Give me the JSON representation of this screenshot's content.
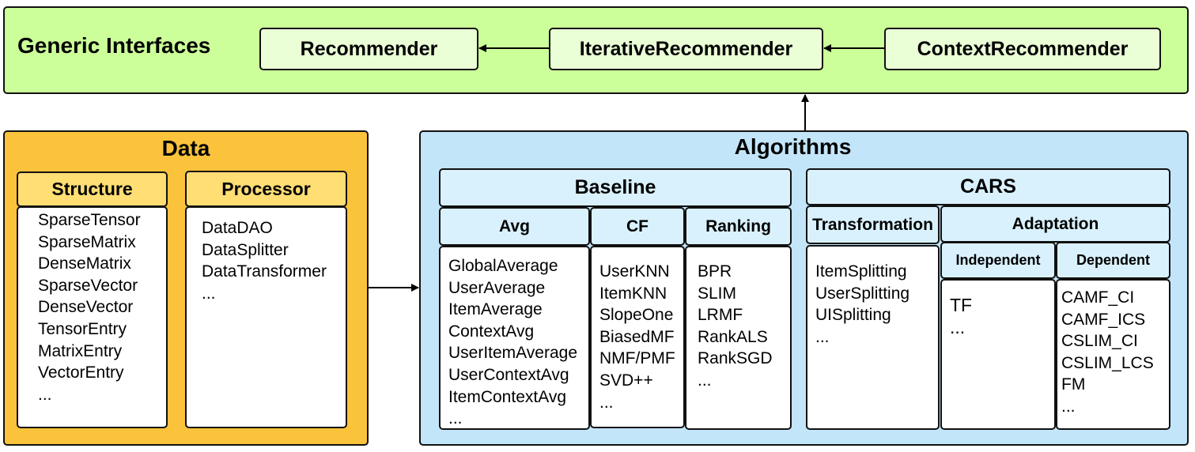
{
  "generic": {
    "title": "Generic Interfaces",
    "recommender": "Recommender",
    "iterative": "IterativeRecommender",
    "context": "ContextRecommender"
  },
  "data": {
    "title": "Data",
    "structure": {
      "label": "Structure",
      "items": [
        "SparseTensor",
        "SparseMatrix",
        "DenseMatrix",
        "SparseVector",
        "DenseVector",
        "TensorEntry",
        "MatrixEntry",
        "VectorEntry",
        "..."
      ]
    },
    "processor": {
      "label": "Processor",
      "items": [
        "DataDAO",
        "DataSplitter",
        "DataTransformer",
        "..."
      ]
    }
  },
  "algorithms": {
    "title": "Algorithms",
    "baseline": {
      "label": "Baseline",
      "avg": {
        "label": "Avg",
        "items": [
          "GlobalAverage",
          "UserAverage",
          "ItemAverage",
          "ContextAvg",
          "UserItemAverage",
          "UserContextAvg",
          "ItemContextAvg",
          "..."
        ]
      },
      "cf": {
        "label": "CF",
        "items": [
          "UserKNN",
          "ItemKNN",
          "SlopeOne",
          "BiasedMF",
          "NMF/PMF",
          "SVD++",
          "..."
        ]
      },
      "ranking": {
        "label": "Ranking",
        "items": [
          "BPR",
          "SLIM",
          "LRMF",
          "RankALS",
          "RankSGD",
          "..."
        ]
      }
    },
    "cars": {
      "label": "CARS",
      "transformation": {
        "label": "Transformation",
        "items": [
          "ItemSplitting",
          "UserSplitting",
          "UISplitting",
          "..."
        ]
      },
      "adaptation": {
        "label": "Adaptation",
        "independent": {
          "label": "Independent",
          "items": [
            "TF",
            "..."
          ]
        },
        "dependent": {
          "label": "Dependent",
          "items": [
            "CAMF_CI",
            "CAMF_ICS",
            "CSLIM_CI",
            "CSLIM_LCS",
            "FM",
            "..."
          ]
        }
      }
    }
  },
  "colors": {
    "generic": "#ccff99",
    "data": "#fbc33b",
    "data_header": "#ffde74",
    "algorithms": "#c3e5fa",
    "algorithms_header": "#d9f1fc"
  }
}
